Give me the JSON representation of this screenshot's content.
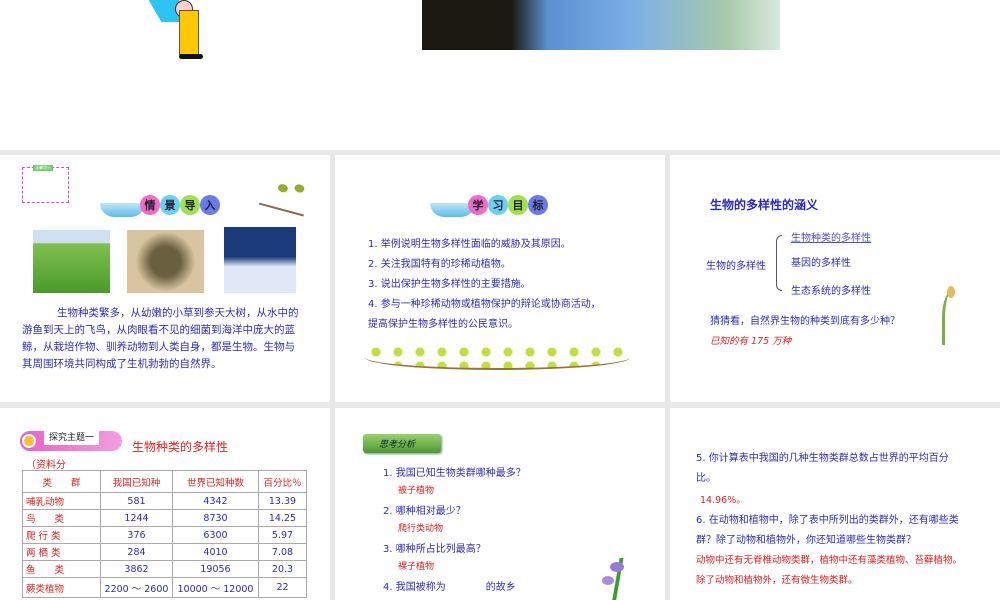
{
  "slides": [
    {
      "title_chars": [
        "情",
        "景",
        "导",
        "入"
      ],
      "note": "温馨提示",
      "body": "生物种类繁多，从幼嫩的小草到参天大树，从水中的游鱼到天上的飞鸟，从肉眼看不见的细菌到海洋中庞大的蓝鲸，从栽培作物、驯养动物到人类自身，都是生物。生物与其周围环境共同构成了生机勃勃的自然界。"
    },
    {
      "title_chars": [
        "学",
        "习",
        "目",
        "标"
      ],
      "items": [
        "1. 举例说明生物多样性面临的威胁及其原因。",
        "2. 关注我国特有的珍稀动植物。",
        "3. 说出保护生物多样性的主要措施。",
        "4. 参与一种珍稀动物或植物保护的辩论或协商活动，",
        "提高保护生物多样性的公民意识。"
      ]
    },
    {
      "title": "生物的多样性的涵义",
      "root": "生物的多样性",
      "branches": [
        "生物种类的多样性",
        "基因的多样性",
        "生态系统的多样性"
      ],
      "question": "猜猜看，自然界生物的种类到底有多少种？",
      "answer": "已知的有 175 万种"
    },
    {
      "badge": "探究主题一",
      "title": "生物种类的多样性",
      "source": "（资料分",
      "headers": [
        "类　　群",
        "我国已知种",
        "世界已知种数",
        "百分比％"
      ],
      "rows": [
        [
          "哺乳动物",
          "581",
          "4342",
          "13.39"
        ],
        [
          "鸟　　类",
          "1244",
          "8730",
          "14.25"
        ],
        [
          "爬 行 类",
          "376",
          "6300",
          "5.97"
        ],
        [
          "两 栖 类",
          "284",
          "4010",
          "7.08"
        ],
        [
          "鱼　　类",
          "3862",
          "19056",
          "20.3"
        ],
        [
          "蕨类植物",
          "2200 ～ 2600",
          "10000 ～ 12000",
          "22"
        ]
      ]
    },
    {
      "badge": "思考分析",
      "qa": [
        {
          "q": "1. 我国已知生物类群哪种最多？",
          "a": "被子植物"
        },
        {
          "q": "2. 哪种相对最少？",
          "a": "爬行类动物"
        },
        {
          "q": "3. 哪种所占比列最高？",
          "a": "裸子植物"
        }
      ],
      "q4": "4. 我国被称为　　　　的故乡"
    },
    {
      "q5": "5. 你计算表中我国的几种生物类群总数占世界的平均百分比。",
      "a5": "14.96%。",
      "q6": "6. 在动物和植物中，除了表中所列出的类群外，还有哪些类群？除了动物和植物外，你还知道哪些生物类群？",
      "a6": "动物中还有无脊椎动物类群，植物中还有藻类植物、苔藓植物。除了动物和植物外，还有微生物类群。"
    }
  ],
  "colors": {
    "accent_blue": "#2b2bbf",
    "answer_red": "#e02020"
  }
}
